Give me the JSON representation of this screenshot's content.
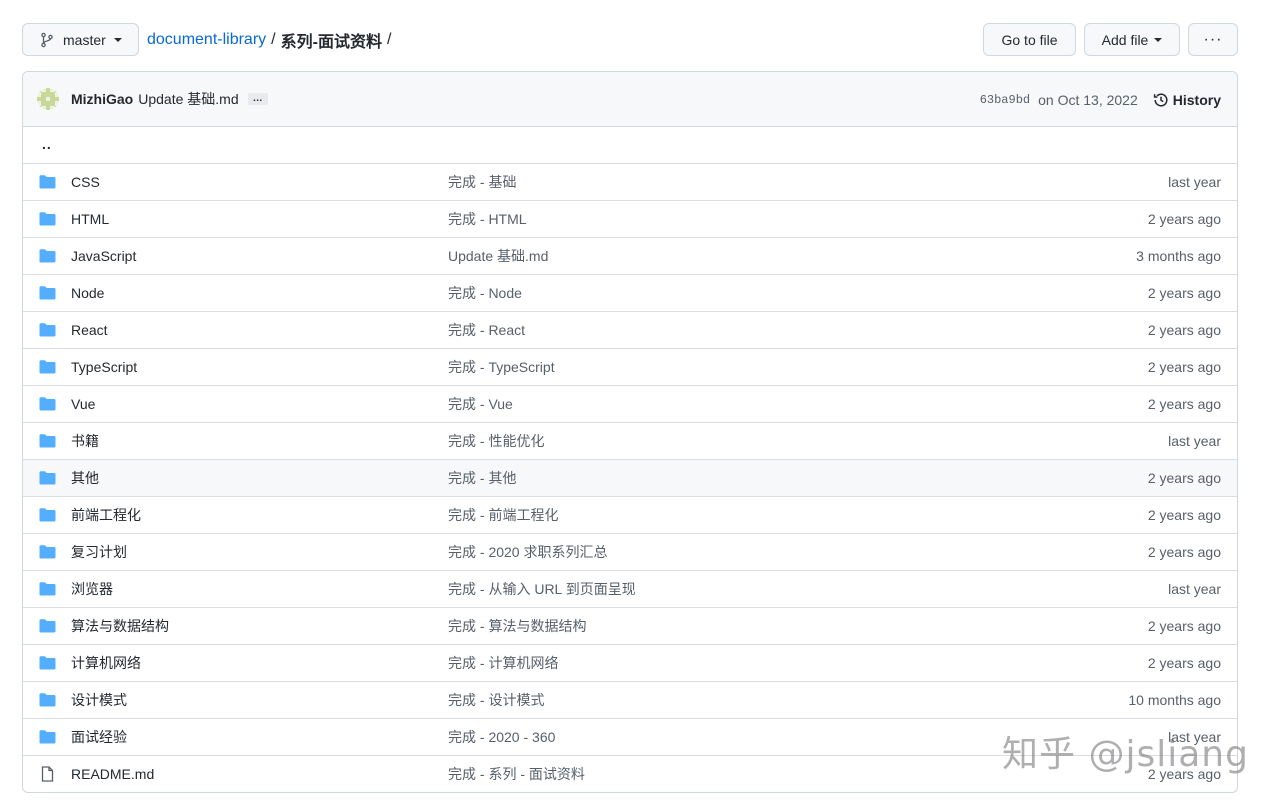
{
  "topbar": {
    "branch": "master",
    "repo": "document-library",
    "sep1": "/",
    "folder": "系列-面试资料",
    "sep2": "/",
    "go_to_file": "Go to file",
    "add_file": "Add file",
    "more": "···"
  },
  "commit": {
    "author": "MizhiGao",
    "message": "Update 基础.md",
    "more": "…",
    "sha": "63ba9bd",
    "date": "on Oct 13, 2022",
    "history": "History"
  },
  "parent_dir": "..",
  "files": [
    {
      "type": "dir",
      "name": "CSS",
      "message": "完成 - 基础",
      "age": "last year"
    },
    {
      "type": "dir",
      "name": "HTML",
      "message": "完成 - HTML",
      "age": "2 years ago"
    },
    {
      "type": "dir",
      "name": "JavaScript",
      "message": "Update 基础.md",
      "age": "3 months ago"
    },
    {
      "type": "dir",
      "name": "Node",
      "message": "完成 - Node",
      "age": "2 years ago"
    },
    {
      "type": "dir",
      "name": "React",
      "message": "完成 - React",
      "age": "2 years ago"
    },
    {
      "type": "dir",
      "name": "TypeScript",
      "message": "完成 - TypeScript",
      "age": "2 years ago"
    },
    {
      "type": "dir",
      "name": "Vue",
      "message": "完成 - Vue",
      "age": "2 years ago"
    },
    {
      "type": "dir",
      "name": "书籍",
      "message": "完成 - 性能优化",
      "age": "last year"
    },
    {
      "type": "dir",
      "name": "其他",
      "message": "完成 - 其他",
      "age": "2 years ago"
    },
    {
      "type": "dir",
      "name": "前端工程化",
      "message": "完成 - 前端工程化",
      "age": "2 years ago"
    },
    {
      "type": "dir",
      "name": "复习计划",
      "message": "完成 - 2020 求职系列汇总",
      "age": "2 years ago"
    },
    {
      "type": "dir",
      "name": "浏览器",
      "message": "完成 - 从输入 URL 到页面呈现",
      "age": "last year"
    },
    {
      "type": "dir",
      "name": "算法与数据结构",
      "message": "完成 - 算法与数据结构",
      "age": "2 years ago"
    },
    {
      "type": "dir",
      "name": "计算机网络",
      "message": "完成 - 计算机网络",
      "age": "2 years ago"
    },
    {
      "type": "dir",
      "name": "设计模式",
      "message": "完成 - 设计模式",
      "age": "10 months ago"
    },
    {
      "type": "dir",
      "name": "面试经验",
      "message": "完成 - 2020 - 360",
      "age": "last year"
    },
    {
      "type": "file",
      "name": "README.md",
      "message": "完成 - 系列 - 面试资料",
      "age": "2 years ago"
    }
  ],
  "watermark": "知乎 @jsliang",
  "colors": {
    "folder": "#54aeff",
    "link": "#0969da",
    "muted": "#57606a",
    "border": "#d0d7de"
  },
  "icons": {
    "branch": "git-branch-icon",
    "folder": "folder-icon",
    "file": "file-icon",
    "history": "history-icon"
  }
}
